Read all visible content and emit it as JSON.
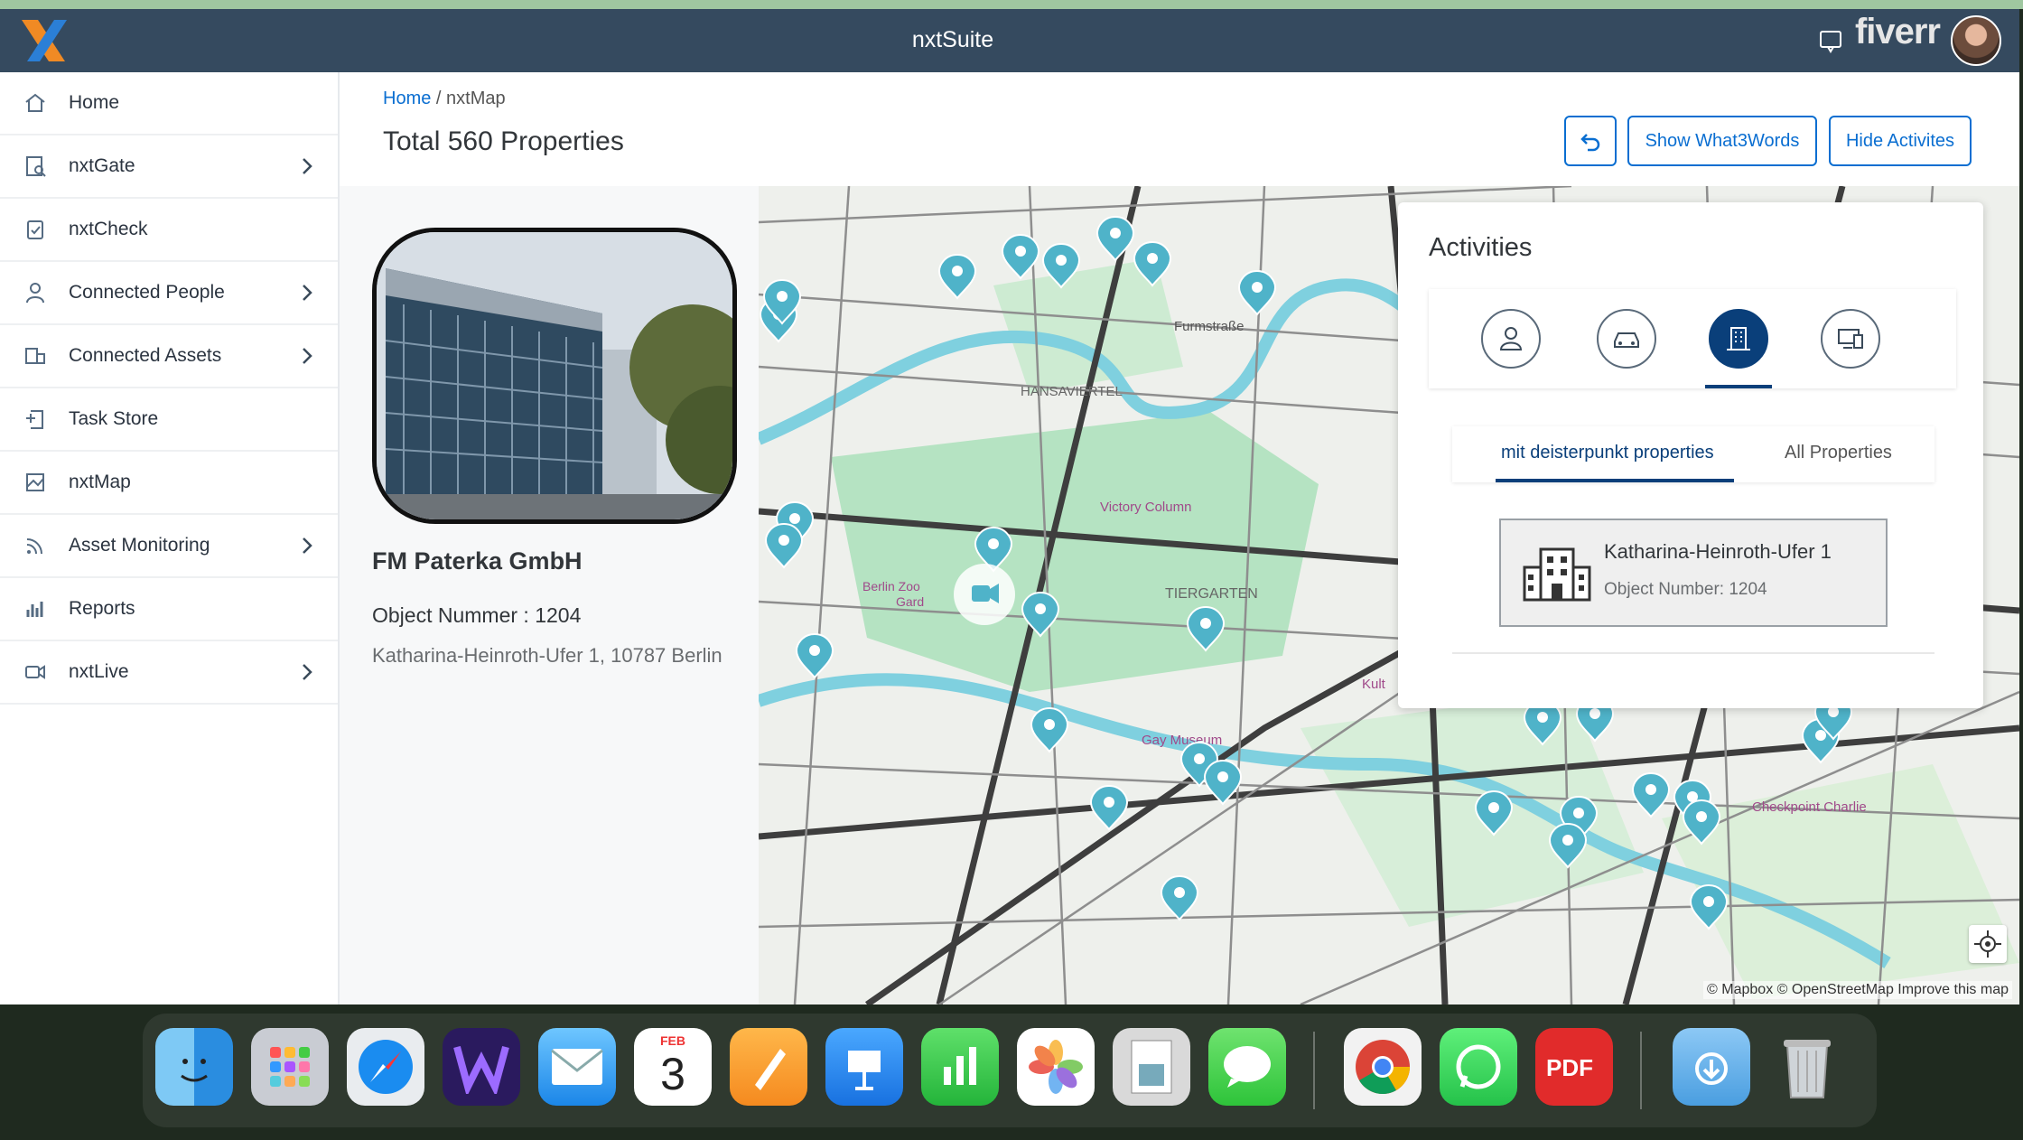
{
  "app": {
    "title": "nxtSuite",
    "brand_badge": "fiverr"
  },
  "sidebar": {
    "items": [
      {
        "label": "Home",
        "icon": "home-icon",
        "has_children": false
      },
      {
        "label": "nxtGate",
        "icon": "gate-icon",
        "has_children": true
      },
      {
        "label": "nxtCheck",
        "icon": "clipboard-check-icon",
        "has_children": false
      },
      {
        "label": "Connected People",
        "icon": "person-icon",
        "has_children": true
      },
      {
        "label": "Connected Assets",
        "icon": "assets-icon",
        "has_children": true
      },
      {
        "label": "Task Store",
        "icon": "task-store-icon",
        "has_children": false
      },
      {
        "label": "nxtMap",
        "icon": "map-icon",
        "has_children": false
      },
      {
        "label": "Asset Monitoring",
        "icon": "signal-icon",
        "has_children": true
      },
      {
        "label": "Reports",
        "icon": "reports-icon",
        "has_children": false
      },
      {
        "label": "nxtLive",
        "icon": "video-camera-icon",
        "has_children": true
      }
    ]
  },
  "breadcrumb": {
    "home": "Home",
    "separator": " / ",
    "current": "nxtMap"
  },
  "header": {
    "title": "Total 560 Properties",
    "buttons": {
      "back_icon": "undo-icon",
      "what3words": "Show What3Words",
      "hide_activities": "Hide Activites"
    }
  },
  "property": {
    "company": "FM Paterka GmbH",
    "object_number": "Object Nummer : 1204",
    "address": "Katharina-Heinroth-Ufer 1, 10787 Berlin"
  },
  "map": {
    "attribution": "© Mapbox © OpenStreetMap  Improve this map",
    "labels": {
      "furmstrasse": "Furmstraße",
      "hansaviertel": "HANSAVIERTEL",
      "victory_column": "Victory Column",
      "tiergarten": "TIERGARTEN",
      "berlin_zoo": "Berlin Zoo",
      "garden": "Gard",
      "gay_museum": "Gay Museum",
      "kult": "Kult",
      "checkpoint_charlie": "Checkpoint Charlie"
    }
  },
  "activities": {
    "title": "Activities",
    "icons": [
      "person-icon",
      "car-icon",
      "building-icon",
      "device-icon"
    ],
    "active_index": 2,
    "tabs": [
      "mit deisterpunkt properties",
      "All Properties"
    ],
    "active_tab": 0,
    "card": {
      "name": "Katharina-Heinroth-Ufer 1",
      "object_number": "Object Number: 1204"
    }
  },
  "dock": {
    "apps": [
      "Finder",
      "Launchpad",
      "Safari",
      "Visual Studio",
      "Mail",
      "Calendar",
      "Pages",
      "Keynote",
      "Numbers",
      "Photos",
      "Preview",
      "Messages",
      "Chrome",
      "WhatsApp",
      "PDF Expert",
      "Downloads",
      "Trash"
    ],
    "calendar": {
      "month": "FEB",
      "day": "3"
    }
  },
  "colors": {
    "header": "#354a5f",
    "accent": "#0a6ed1",
    "active": "#0a3f7a",
    "pin": "#4fb3c9"
  }
}
